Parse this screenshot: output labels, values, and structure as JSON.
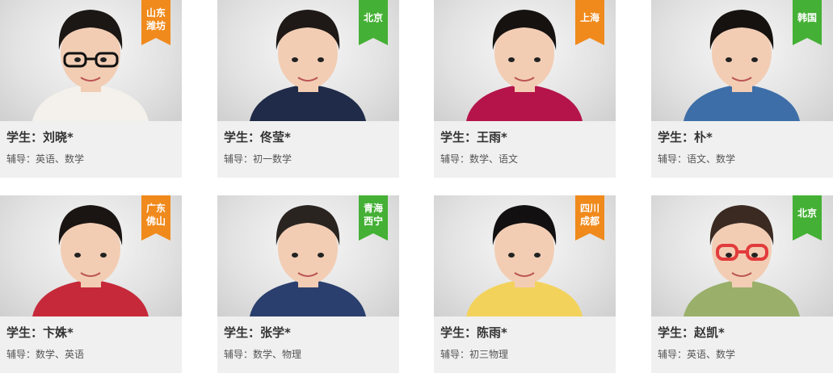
{
  "colors": {
    "orange_tag": "#f08a1c",
    "green_tag": "#44b035",
    "card_bg": "#f0f0f0"
  },
  "students": [
    {
      "name": "学生：刘晓*",
      "subjects": "辅导：英语、数学",
      "location": [
        "山东",
        "潍坊"
      ],
      "tag_color": "orange",
      "shirt": "#f4f1ec",
      "hair": "#1b1714",
      "glasses": "black"
    },
    {
      "name": "学生：佟莹*",
      "subjects": "辅导：初一数学",
      "location": [
        "北京"
      ],
      "tag_color": "green",
      "shirt": "#1f2b48",
      "hair": "#1e1916",
      "glasses": "none"
    },
    {
      "name": "学生：王雨*",
      "subjects": "辅导：数学、语文",
      "location": [
        "上海"
      ],
      "tag_color": "orange",
      "shirt": "#b5144a",
      "hair": "#161210",
      "glasses": "none"
    },
    {
      "name": "学生：朴*",
      "subjects": "辅导：语文、数学",
      "location": [
        "韩国"
      ],
      "tag_color": "green",
      "shirt": "#3d6ea8",
      "hair": "#161210",
      "glasses": "none"
    },
    {
      "name": "学生：卞姝*",
      "subjects": "辅导：数学、英语",
      "location": [
        "广东",
        "佛山"
      ],
      "tag_color": "orange",
      "shirt": "#c62a3a",
      "hair": "#1a1512",
      "glasses": "none"
    },
    {
      "name": "学生：张学*",
      "subjects": "辅导：数学、物理",
      "location": [
        "青海",
        "西宁"
      ],
      "tag_color": "green",
      "shirt": "#2a3f6e",
      "hair": "#2a2420",
      "glasses": "none"
    },
    {
      "name": "学生：陈雨*",
      "subjects": "辅导：初三物理",
      "location": [
        "四川",
        "成都"
      ],
      "tag_color": "orange",
      "shirt": "#f3d25c",
      "hair": "#121010",
      "glasses": "none"
    },
    {
      "name": "学生：赵凯*",
      "subjects": "辅导：英语、数学",
      "location": [
        "北京"
      ],
      "tag_color": "green",
      "shirt": "#9ab06a",
      "hair": "#3a2a22",
      "glasses": "red"
    }
  ]
}
